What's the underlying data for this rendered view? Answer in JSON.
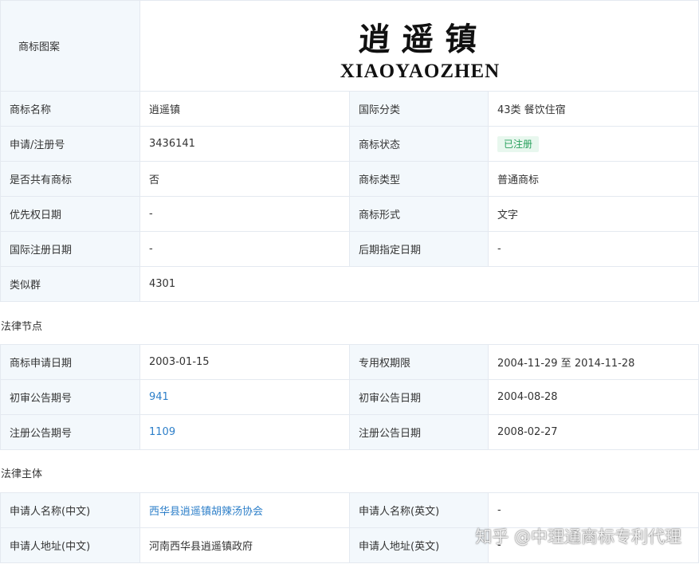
{
  "basic": {
    "logo_label": "商标图案",
    "logo_cn": "逍遥镇",
    "logo_en": "XIAOYAOZHEN",
    "rows": [
      {
        "l1": "商标名称",
        "v1": "逍遥镇",
        "l2": "国际分类",
        "v2": "43类 餐饮住宿"
      },
      {
        "l1": "申请/注册号",
        "v1": "3436141",
        "l2": "商标状态",
        "v2": "已注册"
      },
      {
        "l1": "是否共有商标",
        "v1": "否",
        "l2": "商标类型",
        "v2": "普通商标"
      },
      {
        "l1": "优先权日期",
        "v1": "-",
        "l2": "商标形式",
        "v2": "文字"
      },
      {
        "l1": "国际注册日期",
        "v1": "-",
        "l2": "后期指定日期",
        "v2": "-"
      }
    ],
    "similar_group_label": "类似群",
    "similar_group_value": "4301"
  },
  "legal_nodes": {
    "title": "法律节点",
    "rows": [
      {
        "l1": "商标申请日期",
        "v1": "2003-01-15",
        "l2": "专用权期限",
        "v2": "2004-11-29 至 2014-11-28"
      },
      {
        "l1": "初审公告期号",
        "v1": "941",
        "l2": "初审公告日期",
        "v2": "2004-08-28"
      },
      {
        "l1": "注册公告期号",
        "v1": "1109",
        "l2": "注册公告日期",
        "v2": "2008-02-27"
      }
    ]
  },
  "legal_subject": {
    "title": "法律主体",
    "rows": [
      {
        "l1": "申请人名称(中文)",
        "v1": "西华县逍遥镇胡辣汤协会",
        "l2": "申请人名称(英文)",
        "v2": "-"
      },
      {
        "l1": "申请人地址(中文)",
        "v1": "河南西华县逍遥镇政府",
        "l2": "申请人地址(英文)",
        "v2": "-"
      }
    ]
  },
  "watermark": "知乎 @中理通商标专利代理",
  "colors": {
    "link": "#2d7fc9",
    "status_green": "#2aa15e",
    "label_bg": "#f3f8fc",
    "border": "#e4e9f0"
  }
}
